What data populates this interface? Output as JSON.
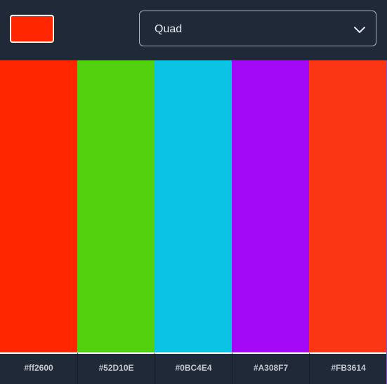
{
  "base_color": "#ff2600",
  "scheme_select": {
    "value": "Quad",
    "icon": "chevron-down-icon"
  },
  "palette": [
    {
      "hex": "#ff2600",
      "color": "#ff2600"
    },
    {
      "hex": "#52D10E",
      "color": "#52D10E"
    },
    {
      "hex": "#0BC4E4",
      "color": "#0BC4E4"
    },
    {
      "hex": "#A308F7",
      "color": "#A308F7"
    },
    {
      "hex": "#FB3614",
      "color": "#FB3614"
    }
  ]
}
